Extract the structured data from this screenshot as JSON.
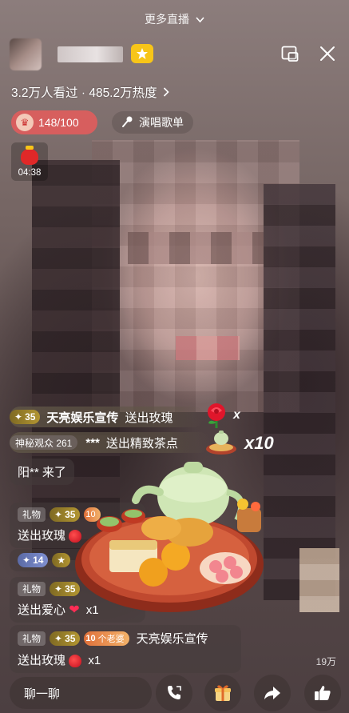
{
  "header": {
    "more_live_label": "更多直播",
    "stats_text": "3.2万人看过 · 485.2万热度",
    "gift_progress": "148/100",
    "songs_label": "演唱歌单",
    "timer": "04:38"
  },
  "icons": {
    "chevron": "chevron-down-icon",
    "pip": "picture-in-picture-icon",
    "close": "close-icon",
    "badge": "star-badge-icon",
    "mic": "microphone-icon",
    "gift_box": "gift-icon",
    "share": "share-icon",
    "like": "thumbs-up-icon",
    "call": "phone-call-icon"
  },
  "gift_banners": [
    {
      "level": "35",
      "name": "天亮娱乐宣传",
      "action": "送出玫瑰",
      "combo": "x"
    },
    {
      "tag": "神秘观众 261",
      "name": "***",
      "action": "送出精致茶点",
      "combo": "x10"
    }
  ],
  "chat": {
    "join_message": "阳** 来了",
    "messages": [
      {
        "tag": "礼物",
        "level": "35",
        "level2": "10",
        "line2": "送出玫瑰",
        "qty": ""
      },
      {
        "level": "14",
        "level_prefix": "★",
        "line2": "",
        "qty": ""
      },
      {
        "tag": "礼物",
        "level": "35",
        "line2": "送出爱心",
        "qty": "x1"
      },
      {
        "tag": "礼物",
        "level": "35",
        "fan_level": "10",
        "fan_name": "个老婆",
        "name": "天亮娱乐宣传",
        "line2": "送出玫瑰",
        "qty": "x1"
      }
    ]
  },
  "viewer_count": "19万",
  "bottom": {
    "chat_placeholder": "聊一聊"
  }
}
